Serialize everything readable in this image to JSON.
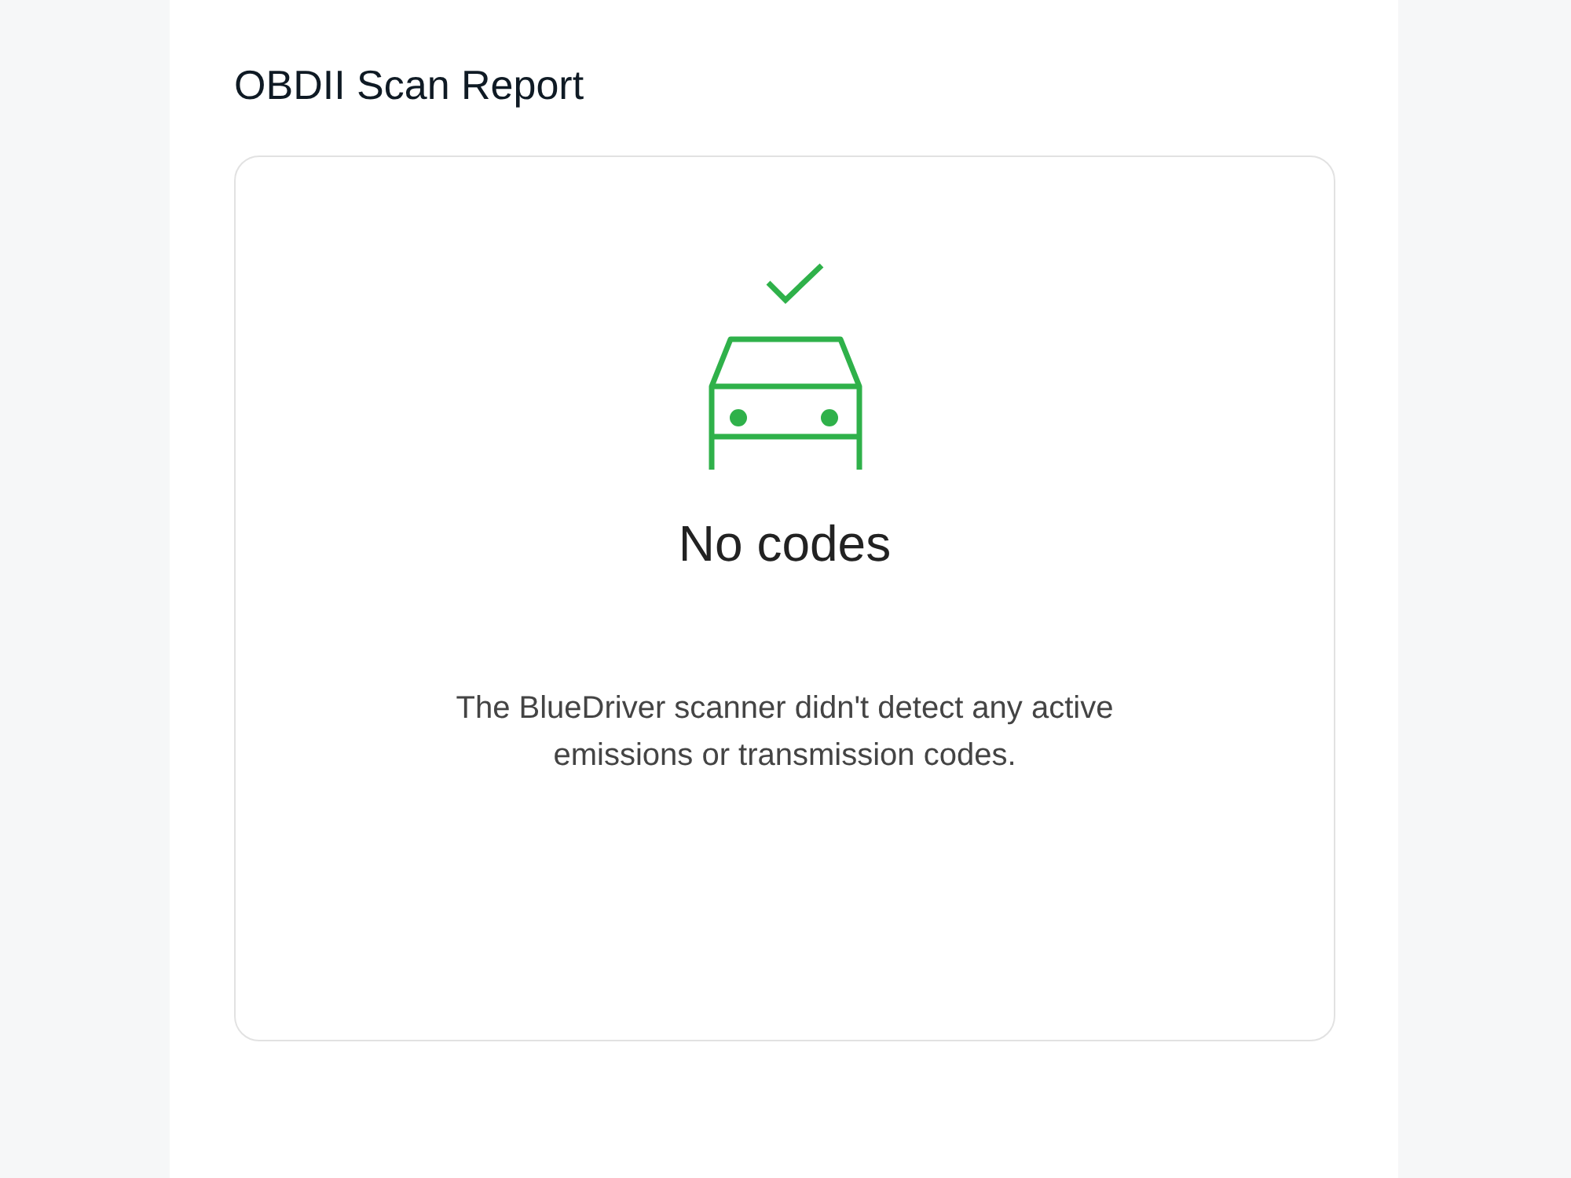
{
  "title": "OBDII Scan Report",
  "result": {
    "heading": "No codes",
    "message": "The BlueDriver scanner didn't detect any active emissions or transmission codes."
  }
}
